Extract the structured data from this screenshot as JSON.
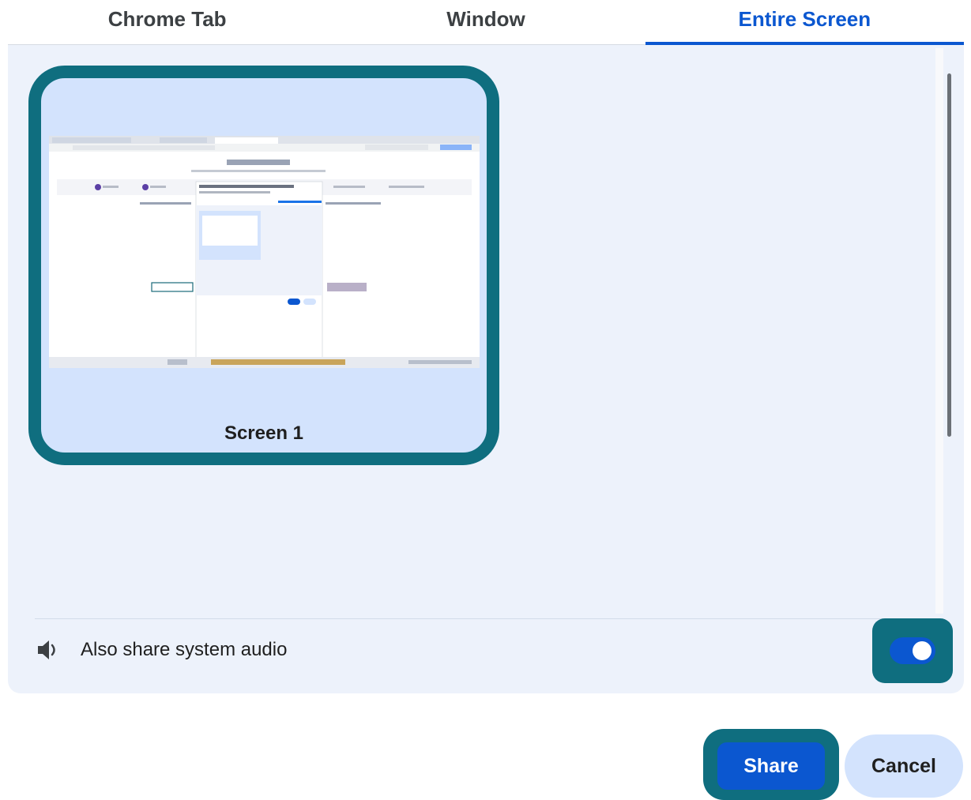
{
  "tabs": [
    {
      "label": "Chrome Tab",
      "active": false
    },
    {
      "label": "Window",
      "active": false
    },
    {
      "label": "Entire Screen",
      "active": true
    }
  ],
  "screens": [
    {
      "label": "Screen 1",
      "selected": true
    }
  ],
  "audio": {
    "label": "Also share system audio",
    "enabled": true,
    "icon": "speaker-icon"
  },
  "buttons": {
    "share": "Share",
    "cancel": "Cancel"
  },
  "colors": {
    "accent": "#0b57d0",
    "focus_ring": "#0f6e7f",
    "panel_bg": "#edf2fb",
    "card_bg": "#d3e3fd"
  }
}
